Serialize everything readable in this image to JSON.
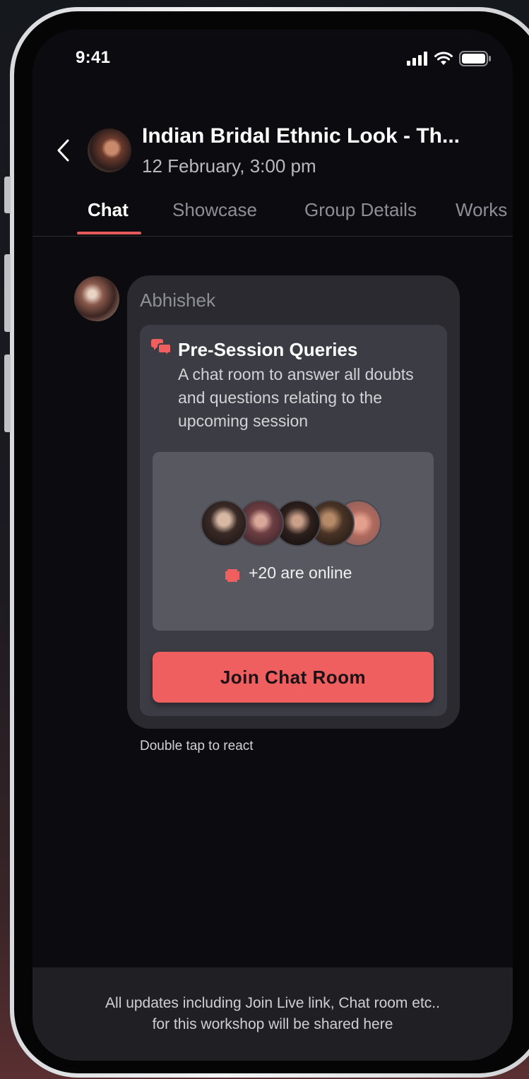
{
  "status_bar": {
    "time": "9:41"
  },
  "header": {
    "title": "Indian Bridal Ethnic Look - Th...",
    "date": "12 February, 3:00 pm"
  },
  "tabs": [
    {
      "label": "Chat",
      "active": true
    },
    {
      "label": "Showcase",
      "active": false
    },
    {
      "label": "Group Details",
      "active": false
    },
    {
      "label": "Works",
      "active": false
    }
  ],
  "message": {
    "sender": "Abhishek",
    "card": {
      "title": "Pre-Session Queries",
      "description": "A chat room to answer all doubts and questions relating to the upcoming session",
      "online_text": "+20 are online",
      "button_label": "Join Chat Room"
    },
    "react_hint": "Double tap to react"
  },
  "footer": {
    "line1": "All updates including Join Live link, Chat room etc..",
    "line2": "for this workshop will be shared here"
  },
  "colors": {
    "accent": "#ef5f5f",
    "tab_underline": "#e45a5a",
    "screen_bg": "#0c0c10",
    "bubble_bg": "#2a2a30",
    "card_bg": "#3c3c44"
  },
  "icons": [
    "back-chevron-icon",
    "signal-icon",
    "wifi-icon",
    "battery-icon",
    "chat-bubbles-icon",
    "online-dot-icon"
  ]
}
